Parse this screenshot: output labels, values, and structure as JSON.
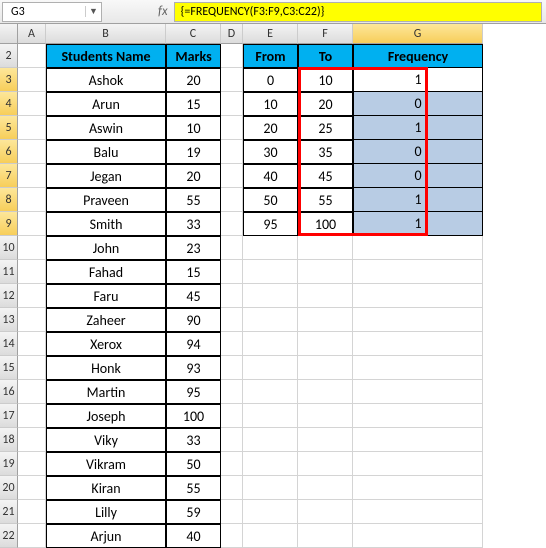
{
  "nameBox": "G3",
  "formula": "{=FREQUENCY(F3:F9,C3:C22)}",
  "columns": [
    "A",
    "B",
    "C",
    "D",
    "E",
    "F",
    "G"
  ],
  "activeCol": "G",
  "headers1": {
    "studentsName": "Students Name",
    "marks": "Marks"
  },
  "headers2": {
    "from": "From",
    "to": "To",
    "frequency": "Frequency"
  },
  "students": [
    {
      "name": "Ashok",
      "marks": 20
    },
    {
      "name": "Arun",
      "marks": 15
    },
    {
      "name": "Aswin",
      "marks": 10
    },
    {
      "name": "Balu",
      "marks": 19
    },
    {
      "name": "Jegan",
      "marks": 20
    },
    {
      "name": "Praveen",
      "marks": 55
    },
    {
      "name": "Smith",
      "marks": 33
    },
    {
      "name": "John",
      "marks": 23
    },
    {
      "name": "Fahad",
      "marks": 15
    },
    {
      "name": "Faru",
      "marks": 45
    },
    {
      "name": "Zaheer",
      "marks": 90
    },
    {
      "name": "Xerox",
      "marks": 94
    },
    {
      "name": "Honk",
      "marks": 93
    },
    {
      "name": "Martin",
      "marks": 95
    },
    {
      "name": "Joseph",
      "marks": 100
    },
    {
      "name": "Viky",
      "marks": 33
    },
    {
      "name": "Vikram",
      "marks": 50
    },
    {
      "name": "Kiran",
      "marks": 55
    },
    {
      "name": "Lilly",
      "marks": 59
    },
    {
      "name": "Arjun",
      "marks": 40
    }
  ],
  "ranges": [
    {
      "from": 0,
      "to": 10,
      "freq": 1
    },
    {
      "from": 10,
      "to": 20,
      "freq": 0
    },
    {
      "from": 20,
      "to": 25,
      "freq": 1
    },
    {
      "from": 30,
      "to": 35,
      "freq": 0
    },
    {
      "from": 40,
      "to": 45,
      "freq": 0
    },
    {
      "from": 50,
      "to": 55,
      "freq": 1
    },
    {
      "from": 95,
      "to": 100,
      "freq": 1
    }
  ],
  "rowStart": 2,
  "rowEnd": 22,
  "activeRows": [
    3,
    4,
    5,
    6,
    7,
    8,
    9
  ]
}
